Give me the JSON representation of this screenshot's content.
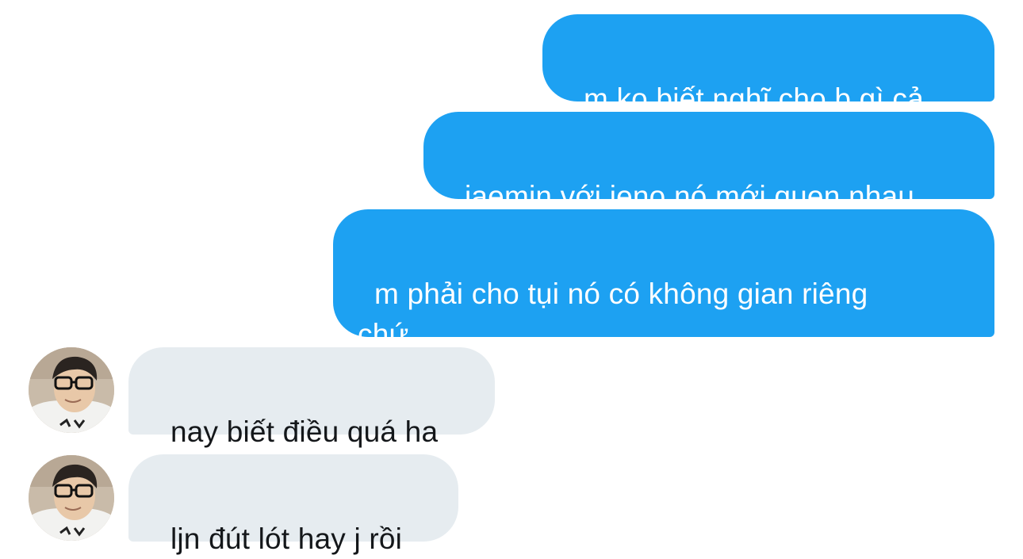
{
  "messages": {
    "sent": [
      {
        "text": "m ko biết nghĩ cho b gì cả"
      },
      {
        "text": "jaemin với jeno nó mới quen nhau"
      },
      {
        "text": "m phải cho tụi nó có không gian riêng\nchứ"
      }
    ],
    "received": [
      {
        "text": "nay biết điều quá ha",
        "avatar": "avatar-icon"
      },
      {
        "text": "ljn đút lót hay j rồi",
        "avatar": "avatar-icon"
      }
    ]
  },
  "colors": {
    "sent_bubble": "#1da1f2",
    "sent_text": "#ffffff",
    "received_bubble": "#e6ecf0",
    "received_text": "#14171a"
  }
}
